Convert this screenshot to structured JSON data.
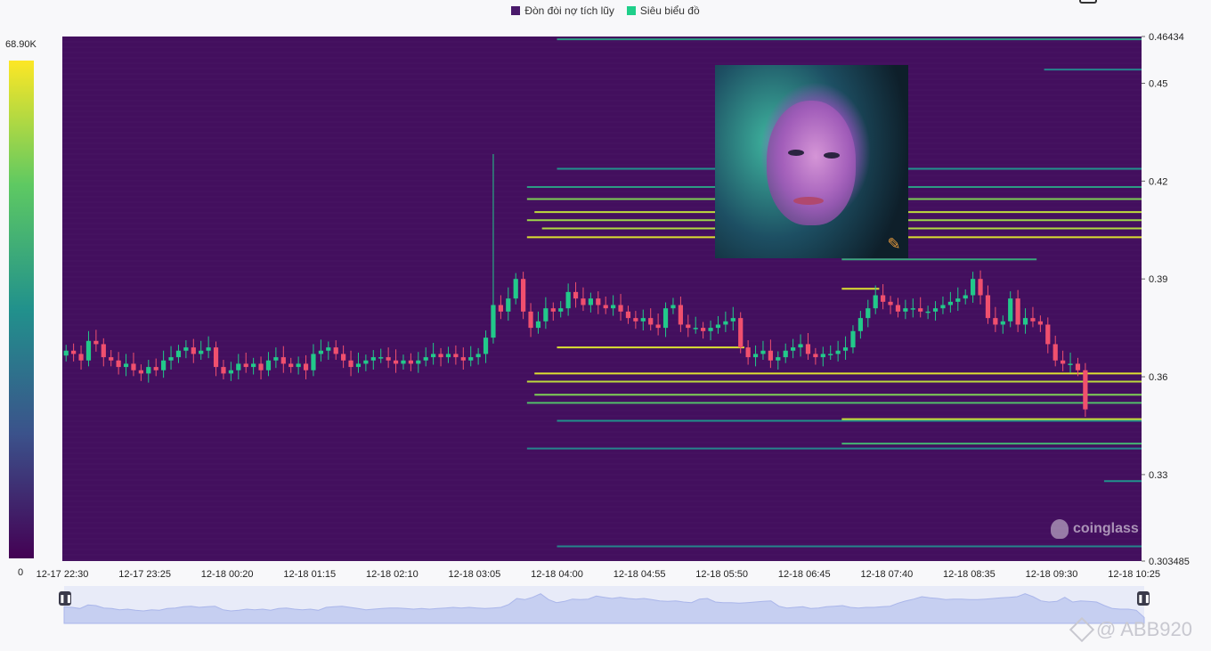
{
  "legend": {
    "items": [
      {
        "label": "Đòn đòi nợ tích lũy",
        "color": "#4a1a6b"
      },
      {
        "label": "Siêu biểu đồ",
        "color": "#1fcf8a"
      }
    ]
  },
  "colorbar": {
    "max_label": "68.90K",
    "min_label": "0"
  },
  "watermark": {
    "text": "coinglass"
  },
  "credit": {
    "text": "@ ABB920"
  },
  "colors": {
    "bg": "#430f5e",
    "up": "#22c98a",
    "down": "#f0506e",
    "wick": "#1fcf8a"
  },
  "chart_data": {
    "type": "heatmap",
    "ylim": [
      0.303485,
      0.46434
    ],
    "y_ticks": [
      {
        "value": 0.46434,
        "label": "0.46434"
      },
      {
        "value": 0.45,
        "label": "0.45"
      },
      {
        "value": 0.42,
        "label": "0.42"
      },
      {
        "value": 0.39,
        "label": "0.39"
      },
      {
        "value": 0.36,
        "label": "0.36"
      },
      {
        "value": 0.33,
        "label": "0.33"
      },
      {
        "value": 0.303485,
        "label": "0.303485"
      }
    ],
    "x_range": [
      0,
      144
    ],
    "x_ticks": [
      {
        "index": 0,
        "label": "12-17 22:30"
      },
      {
        "index": 11,
        "label": "12-17 23:25"
      },
      {
        "index": 22,
        "label": "12-18 00:20"
      },
      {
        "index": 33,
        "label": "12-18 01:15"
      },
      {
        "index": 44,
        "label": "12-18 02:10"
      },
      {
        "index": 55,
        "label": "12-18 03:05"
      },
      {
        "index": 66,
        "label": "12-18 04:00"
      },
      {
        "index": 77,
        "label": "12-18 04:55"
      },
      {
        "index": 88,
        "label": "12-18 05:50"
      },
      {
        "index": 99,
        "label": "12-18 06:45"
      },
      {
        "index": 110,
        "label": "12-18 07:40"
      },
      {
        "index": 121,
        "label": "12-18 08:35"
      },
      {
        "index": 132,
        "label": "12-18 09:30"
      },
      {
        "index": 143,
        "label": "12-18 10:25"
      }
    ],
    "price_close": [
      0.368,
      0.367,
      0.365,
      0.371,
      0.37,
      0.366,
      0.365,
      0.363,
      0.364,
      0.362,
      0.361,
      0.363,
      0.362,
      0.365,
      0.366,
      0.368,
      0.369,
      0.367,
      0.368,
      0.369,
      0.363,
      0.361,
      0.362,
      0.364,
      0.363,
      0.364,
      0.362,
      0.365,
      0.366,
      0.364,
      0.363,
      0.364,
      0.362,
      0.367,
      0.368,
      0.369,
      0.367,
      0.365,
      0.363,
      0.364,
      0.365,
      0.366,
      0.366,
      0.365,
      0.364,
      0.365,
      0.364,
      0.365,
      0.366,
      0.367,
      0.366,
      0.367,
      0.366,
      0.365,
      0.366,
      0.367,
      0.372,
      0.382,
      0.38,
      0.384,
      0.39,
      0.38,
      0.375,
      0.377,
      0.381,
      0.38,
      0.381,
      0.386,
      0.384,
      0.382,
      0.384,
      0.382,
      0.381,
      0.382,
      0.38,
      0.378,
      0.377,
      0.378,
      0.376,
      0.375,
      0.381,
      0.382,
      0.376,
      0.375,
      0.375,
      0.374,
      0.375,
      0.376,
      0.377,
      0.378,
      0.369,
      0.366,
      0.367,
      0.368,
      0.365,
      0.366,
      0.368,
      0.369,
      0.37,
      0.367,
      0.366,
      0.367,
      0.367,
      0.368,
      0.369,
      0.374,
      0.378,
      0.381,
      0.385,
      0.383,
      0.382,
      0.38,
      0.381,
      0.381,
      0.38,
      0.38,
      0.381,
      0.382,
      0.383,
      0.384,
      0.385,
      0.39,
      0.385,
      0.378,
      0.376,
      0.377,
      0.384,
      0.376,
      0.378,
      0.377,
      0.376,
      0.37,
      0.365,
      0.364,
      0.364,
      0.362,
      0.35
    ],
    "candle_spike": {
      "index": 57,
      "high": 0.4283
    },
    "liquidity_bands": [
      {
        "price": 0.4635,
        "x_start": 66,
        "x_end": 144,
        "intensity": 0.55
      },
      {
        "price": 0.4542,
        "x_start": 131,
        "x_end": 144,
        "intensity": 0.45
      },
      {
        "price": 0.4238,
        "x_start": 66,
        "x_end": 144,
        "intensity": 0.5
      },
      {
        "price": 0.4182,
        "x_start": 62,
        "x_end": 144,
        "intensity": 0.55
      },
      {
        "price": 0.4145,
        "x_start": 62,
        "x_end": 144,
        "intensity": 0.8
      },
      {
        "price": 0.4105,
        "x_start": 63,
        "x_end": 144,
        "intensity": 0.9
      },
      {
        "price": 0.408,
        "x_start": 62,
        "x_end": 144,
        "intensity": 0.85
      },
      {
        "price": 0.4055,
        "x_start": 64,
        "x_end": 144,
        "intensity": 0.88
      },
      {
        "price": 0.4028,
        "x_start": 62,
        "x_end": 144,
        "intensity": 0.95
      },
      {
        "price": 0.396,
        "x_start": 104,
        "x_end": 130,
        "intensity": 0.6
      },
      {
        "price": 0.387,
        "x_start": 104,
        "x_end": 109,
        "intensity": 0.95
      },
      {
        "price": 0.369,
        "x_start": 66,
        "x_end": 91,
        "intensity": 0.95
      },
      {
        "price": 0.361,
        "x_start": 63,
        "x_end": 144,
        "intensity": 0.95
      },
      {
        "price": 0.3585,
        "x_start": 62,
        "x_end": 144,
        "intensity": 0.9
      },
      {
        "price": 0.3545,
        "x_start": 63,
        "x_end": 144,
        "intensity": 0.8
      },
      {
        "price": 0.352,
        "x_start": 62,
        "x_end": 144,
        "intensity": 0.7
      },
      {
        "price": 0.3465,
        "x_start": 66,
        "x_end": 144,
        "intensity": 0.5
      },
      {
        "price": 0.347,
        "x_start": 104,
        "x_end": 144,
        "intensity": 0.92
      },
      {
        "price": 0.3395,
        "x_start": 104,
        "x_end": 144,
        "intensity": 0.65
      },
      {
        "price": 0.338,
        "x_start": 62,
        "x_end": 144,
        "intensity": 0.45
      },
      {
        "price": 0.328,
        "x_start": 139,
        "x_end": 144,
        "intensity": 0.5
      },
      {
        "price": 0.308,
        "x_start": 66,
        "x_end": 144,
        "intensity": 0.45
      }
    ]
  }
}
